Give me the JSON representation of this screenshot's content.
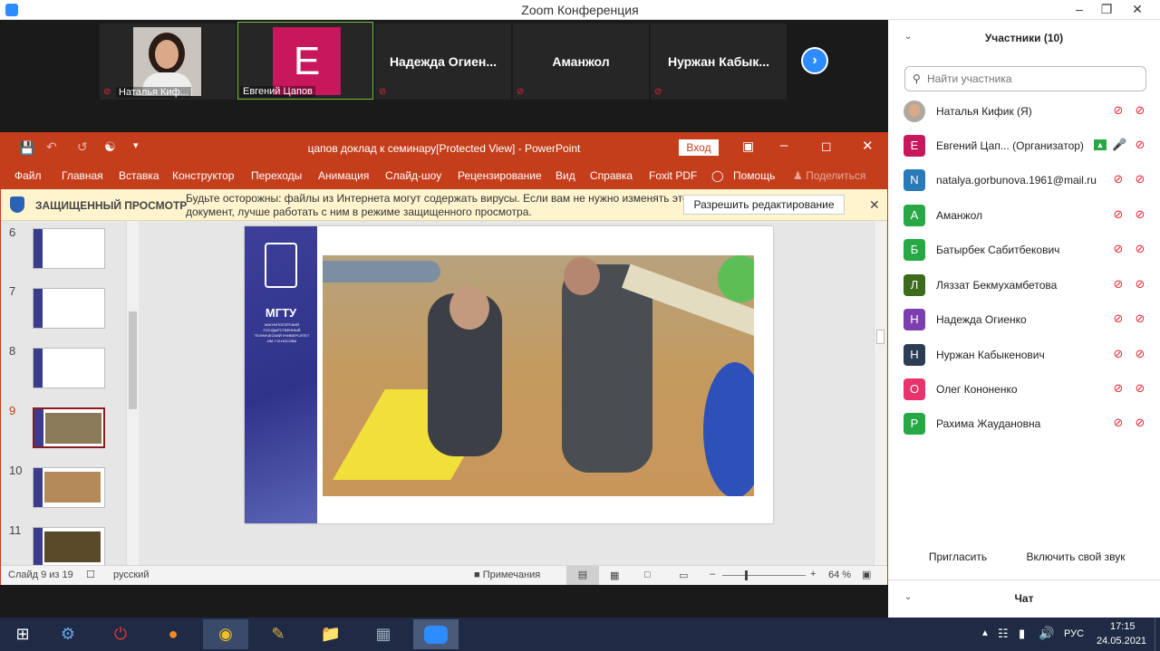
{
  "window": {
    "title": "Zoom Конференция"
  },
  "videos": [
    {
      "name": "Наталья Киф...",
      "type": "photo"
    },
    {
      "name": "Евгений Цапов",
      "type": "avatar",
      "initial": "E"
    },
    {
      "name": "Надежда  Огиен...",
      "type": "name"
    },
    {
      "name": "Аманжол",
      "type": "name"
    },
    {
      "name": "Нуржан  Кабык...",
      "type": "name"
    }
  ],
  "ppt": {
    "doc_title": "цапов доклад к семинару[Protected View]  -  PowerPoint",
    "login": "Вход",
    "menu": [
      "Файл",
      "Главная",
      "Вставка",
      "Конструктор",
      "Переходы",
      "Анимация",
      "Слайд-шоу",
      "Рецензирование",
      "Вид",
      "Справка",
      "Foxit PDF",
      "Помощь",
      "Поделиться"
    ],
    "warn_title": "ЗАЩИЩЕННЫЙ ПРОСМОТР",
    "warn_text1": "Будьте осторожны: файлы из Интернета могут содержать вирусы. Если вам не нужно изменять этот",
    "warn_text2": "документ, лучше работать с ним в режиме защищенного просмотра.",
    "enable_edit": "Разрешить редактирование",
    "thumb_numbers": [
      "6",
      "7",
      "8",
      "9",
      "10",
      "11"
    ],
    "slide_logo": "МГТУ",
    "slide_uni": "МАГНИТОГОРСКИЙ ГОСУДАРСТВЕННЫЙ ТЕХНИЧЕСКИЙ УНИВЕРСИТЕТ ИМ. Г.И.НОСОВА",
    "status_slide": "Слайд 9 из 19",
    "status_lang": "русский",
    "notes": "Примечания",
    "zoom": "64 %"
  },
  "participants": {
    "header": "Участники (10)",
    "search_placeholder": "Найти участника",
    "list": [
      {
        "name": "Наталья Кифик (Я)",
        "initial": "",
        "color": "#b0a89e",
        "mic": "off",
        "video": "off"
      },
      {
        "name": "Евгений Цап...  (Организатор)",
        "initial": "E",
        "color": "#c8175d",
        "mic": "on",
        "video": "off"
      },
      {
        "name": "natalya.gorbunova.1961@mail.ru",
        "initial": "N",
        "color": "#2a7ab8",
        "mic": "off",
        "video": "off"
      },
      {
        "name": "Аманжол",
        "initial": "A",
        "color": "#27a844",
        "mic": "off",
        "video": "off"
      },
      {
        "name": "Батырбек Сабитбекович",
        "initial": "Б",
        "color": "#27a844",
        "mic": "off",
        "video": "off"
      },
      {
        "name": "Ляззат Бекмухамбетова",
        "initial": "Л",
        "color": "#3c6b1e",
        "mic": "off",
        "video": "off"
      },
      {
        "name": "Надежда Огиенко",
        "initial": "Н",
        "color": "#7d3fb0",
        "mic": "off",
        "video": "off"
      },
      {
        "name": "Нуржан Кабыкенович",
        "initial": "Н",
        "color": "#2c3e55",
        "mic": "off",
        "video": "off"
      },
      {
        "name": "Олег Кононенко",
        "initial": "O",
        "color": "#e8336d",
        "mic": "off",
        "video": "off"
      },
      {
        "name": "Рахима Жаудановна",
        "initial": "P",
        "color": "#27a844",
        "mic": "off",
        "video": "off"
      }
    ],
    "invite": "Пригласить",
    "unmute": "Включить свой звук",
    "chat": "Чат"
  },
  "taskbar": {
    "lang": "РУС",
    "time": "17:15",
    "date": "24.05.2021"
  }
}
